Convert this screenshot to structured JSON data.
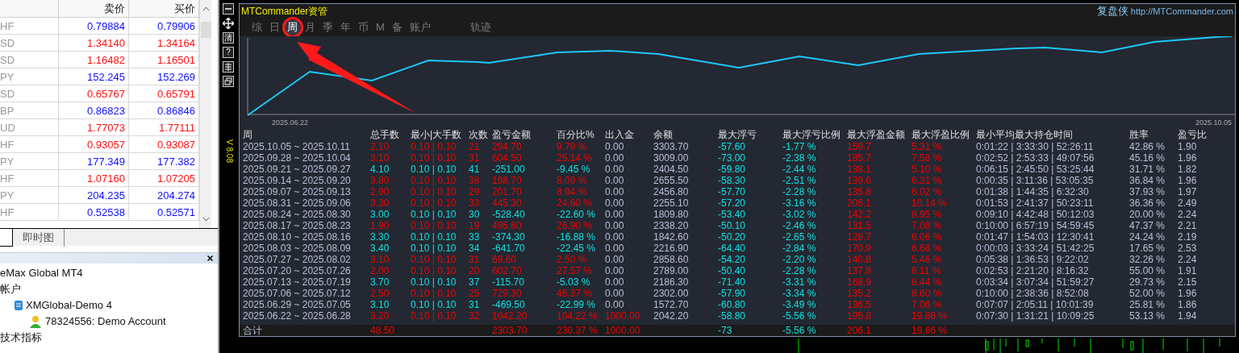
{
  "market_watch": {
    "columns": [
      "卖价",
      "买价"
    ],
    "rows": [
      {
        "symbol": "HF",
        "bid": "0.79884",
        "ask": "0.79906",
        "color": "#1010ff"
      },
      {
        "symbol": "SD",
        "bid": "1.34140",
        "ask": "1.34164",
        "color": "#ff1010"
      },
      {
        "symbol": "SD",
        "bid": "1.16482",
        "ask": "1.16501",
        "color": "#ff1010"
      },
      {
        "symbol": "PY",
        "bid": "152.245",
        "ask": "152.269",
        "color": "#1010ff"
      },
      {
        "symbol": "SD",
        "bid": "0.65767",
        "ask": "0.65791",
        "color": "#ff1010"
      },
      {
        "symbol": "BP",
        "bid": "0.86823",
        "ask": "0.86846",
        "color": "#1010ff"
      },
      {
        "symbol": "UD",
        "bid": "1.77073",
        "ask": "1.77111",
        "color": "#ff1010"
      },
      {
        "symbol": "HF",
        "bid": "0.93057",
        "ask": "0.93087",
        "color": "#ff1010"
      },
      {
        "symbol": "PY",
        "bid": "177.349",
        "ask": "177.382",
        "color": "#1010ff"
      },
      {
        "symbol": "HF",
        "bid": "1.07160",
        "ask": "1.07205",
        "color": "#ff1010"
      },
      {
        "symbol": "PY",
        "bid": "204.235",
        "ask": "204.274",
        "color": "#1010ff"
      },
      {
        "symbol": "HF",
        "bid": "0.52538",
        "ask": "0.52571",
        "color": "#1010ff"
      }
    ]
  },
  "bottom_tabs": [
    {
      "label": "即时图",
      "selected": false
    }
  ],
  "navigator": {
    "items": [
      {
        "label": "eMax Global MT4",
        "children": [
          {
            "label": "帐户",
            "children": [
              {
                "label": "XMGlobal-Demo 4",
                "children": [
                  {
                    "label": "78324556: Demo Account"
                  }
                ]
              }
            ]
          },
          {
            "label": "技术指标"
          }
        ]
      }
    ]
  },
  "panel": {
    "title": "MTCommander资管",
    "brand": "复盘侠",
    "link": "http://MTCommander.com",
    "version": "V 8.08",
    "toolbar": [
      {
        "kind": "minimize"
      },
      {
        "kind": "move"
      },
      {
        "kind": "text",
        "label": "清"
      },
      {
        "kind": "text",
        "label": "?"
      },
      {
        "kind": "grid"
      },
      {
        "kind": "restore"
      }
    ],
    "tabs": [
      {
        "label": "综",
        "selected": false
      },
      {
        "label": "日",
        "selected": false
      },
      {
        "label": "周",
        "selected": true
      },
      {
        "label": "月",
        "selected": false
      },
      {
        "label": "季",
        "selected": false
      },
      {
        "label": "年",
        "selected": false
      },
      {
        "label": "币",
        "selected": false
      },
      {
        "label": "M",
        "selected": false
      },
      {
        "label": "备",
        "selected": false
      },
      {
        "label": "账户",
        "selected": false
      },
      {
        "label": "轨迹",
        "selected": false
      }
    ],
    "chart": {
      "start_label": "2025.06.22",
      "end_label": "2025.10.05"
    },
    "table": {
      "columns": [
        "周",
        "总手数",
        "最小|大手数",
        "次数",
        "盈亏金额",
        "百分比%",
        "出入金",
        "余额",
        "最大浮亏",
        "最大浮亏比例",
        "最大浮盈金额",
        "最大浮盈比例",
        "最小平均最大持仓时间",
        "胜率",
        "盈亏比"
      ],
      "rows": [
        {
          "kind": "gain",
          "deposit": false,
          "cells": [
            "2025.10.05 ~ 2025.10.11",
            "2.10",
            "0.10 | 0.10",
            "21",
            "294.70",
            "9.79 %",
            "0.00",
            "3303.70",
            "-57.60",
            "-1.77 %",
            "159.7",
            "5.31 %",
            "0:01:22 | 3:33:30 | 52:26:11",
            "42.86 %",
            "1.90"
          ]
        },
        {
          "kind": "gain",
          "deposit": false,
          "cells": [
            "2025.09.28 ~ 2025.10.04",
            "3.10",
            "0.10 | 0.10",
            "31",
            "604.50",
            "25.14 %",
            "0.00",
            "3009.00",
            "-73.00",
            "-2.38 %",
            "185.7",
            "7.58 %",
            "0:02:52 | 2:53:33 | 49:07:56",
            "45.16 %",
            "1.96"
          ]
        },
        {
          "kind": "loss",
          "deposit": false,
          "cells": [
            "2025.09.21 ~ 2025.09.27",
            "4.10",
            "0.10 | 0.10",
            "41",
            "-251.00",
            "-9.45 %",
            "0.00",
            "2404.50",
            "-59.80",
            "-2.44 %",
            "138.1",
            "5.10 %",
            "0:06:15 | 2:45:50 | 53:25:44",
            "31.71 %",
            "1.82"
          ]
        },
        {
          "kind": "gain",
          "deposit": false,
          "cells": [
            "2025.09.14 ~ 2025.09.20",
            "3.80",
            "0.10 | 0.10",
            "38",
            "198.70",
            "8.09 %",
            "0.00",
            "2655.50",
            "-58.30",
            "-2.51 %",
            "139.6",
            "6.31 %",
            "0:00:35 | 3:11:36 | 53:05:35",
            "36.84 %",
            "1.96"
          ]
        },
        {
          "kind": "gain",
          "deposit": false,
          "cells": [
            "2025.09.07 ~ 2025.09.13",
            "2.90",
            "0.10 | 0.10",
            "29",
            "201.70",
            "8.94 %",
            "0.00",
            "2456.80",
            "-57.70",
            "-2.28 %",
            "135.8",
            "6.02 %",
            "0:01:38 | 1:44:35 | 6:32:30",
            "37.93 %",
            "1.97"
          ]
        },
        {
          "kind": "gain",
          "deposit": false,
          "cells": [
            "2025.08.31 ~ 2025.09.06",
            "3.30",
            "0.10 | 0.10",
            "33",
            "445.30",
            "24.60 %",
            "0.00",
            "2255.10",
            "-57.20",
            "-3.16 %",
            "206.1",
            "10.14 %",
            "0:01:53 | 2:41:37 | 50:23:11",
            "36.36 %",
            "2.49"
          ]
        },
        {
          "kind": "loss",
          "deposit": false,
          "cells": [
            "2025.08.24 ~ 2025.08.30",
            "3.00",
            "0.10 | 0.10",
            "30",
            "-528.40",
            "-22.60 %",
            "0.00",
            "1809.80",
            "-53.40",
            "-3.02 %",
            "142.2",
            "8.95 %",
            "0:09:10 | 4:42:48 | 50:12:03",
            "20.00 %",
            "2.24"
          ]
        },
        {
          "kind": "gain",
          "deposit": false,
          "cells": [
            "2025.08.17 ~ 2025.08.23",
            "1.90",
            "0.10 | 0.10",
            "19",
            "495.60",
            "26.90 %",
            "0.00",
            "2338.20",
            "-50.10",
            "-2.46 %",
            "131.5",
            "7.08 %",
            "0:10:00 | 6:57:19 | 54:59:45",
            "47.37 %",
            "2.21"
          ]
        },
        {
          "kind": "loss",
          "deposit": false,
          "cells": [
            "2025.08.10 ~ 2025.08.16",
            "3.30",
            "0.10 | 0.10",
            "33",
            "-374.30",
            "-16.88 %",
            "0.00",
            "1842.60",
            "-50.20",
            "-2.65 %",
            "128.7",
            "6.06 %",
            "0:01:47 | 1:54:03 | 12:30:41",
            "24.24 %",
            "2.19"
          ]
        },
        {
          "kind": "loss",
          "deposit": false,
          "cells": [
            "2025.08.03 ~ 2025.08.09",
            "3.40",
            "0.10 | 0.10",
            "34",
            "-641.70",
            "-22.45 %",
            "0.00",
            "2216.90",
            "-64.40",
            "-2.84 %",
            "170.9",
            "6.68 %",
            "0:00:03 | 3:33:24 | 51:42:25",
            "17.65 %",
            "2.53"
          ]
        },
        {
          "kind": "gain",
          "deposit": false,
          "cells": [
            "2025.07.27 ~ 2025.08.02",
            "3.10",
            "0.10 | 0.10",
            "31",
            "69.60",
            "2.50 %",
            "0.00",
            "2858.60",
            "-54.20",
            "-2.20 %",
            "140.8",
            "5.46 %",
            "0:05:38 | 1:36:53 | 9:22:02",
            "32.26 %",
            "2.24"
          ]
        },
        {
          "kind": "gain",
          "deposit": false,
          "cells": [
            "2025.07.20 ~ 2025.07.26",
            "2.00",
            "0.10 | 0.10",
            "20",
            "602.70",
            "27.57 %",
            "0.00",
            "2789.00",
            "-50.40",
            "-2.28 %",
            "137.8",
            "6.11 %",
            "0:02:53 | 2:21:20 | 8:16:32",
            "55.00 %",
            "1.91"
          ]
        },
        {
          "kind": "loss",
          "deposit": false,
          "cells": [
            "2025.07.13 ~ 2025.07.19",
            "3.70",
            "0.10 | 0.10",
            "37",
            "-115.70",
            "-5.03 %",
            "0.00",
            "2186.30",
            "-71.40",
            "-3.31 %",
            "168.9",
            "8.44 %",
            "0:03:34 | 3:07:34 | 51:59:27",
            "29.73 %",
            "2.15"
          ]
        },
        {
          "kind": "gain",
          "deposit": false,
          "cells": [
            "2025.07.06 ~ 2025.07.12",
            "2.50",
            "0.10 | 0.10",
            "25",
            "729.30",
            "46.37 %",
            "0.00",
            "2302.00",
            "-57.90",
            "-3.34 %",
            "135.2",
            "8.60 %",
            "0:10:00 | 2:38:36 | 8:52:08",
            "52.00 %",
            "1.96"
          ]
        },
        {
          "kind": "loss",
          "deposit": false,
          "cells": [
            "2025.06.29 ~ 2025.07.05",
            "3.10",
            "0.10 | 0.10",
            "31",
            "-469.50",
            "-22.99 %",
            "0.00",
            "1572.70",
            "-60.80",
            "-3.49 %",
            "136.5",
            "7.06 %",
            "0:07:07 | 2:05:11 | 10:01:39",
            "25.81 %",
            "1.86"
          ]
        },
        {
          "kind": "gain",
          "deposit": true,
          "cells": [
            "2025.06.22 ~ 2025.06.28",
            "3.20",
            "0.10 | 0.10",
            "32",
            "1042.20",
            "104.22 %",
            "1000.00",
            "2042.20",
            "-58.80",
            "-5.56 %",
            "195.8",
            "19.86 %",
            "0:07:30 | 1:31:21 | 10:09:25",
            "53.13 %",
            "1.94"
          ]
        }
      ],
      "total": {
        "label": "合计",
        "lots": "48.50",
        "profit": "2303.70",
        "percent": "230.37 %",
        "deposit": "1000.00",
        "max_float_loss": "-73",
        "max_float_loss_pct": "-5.56 %",
        "max_float_profit": "206.1",
        "max_float_profit_pct": "19.86 %"
      }
    }
  }
}
